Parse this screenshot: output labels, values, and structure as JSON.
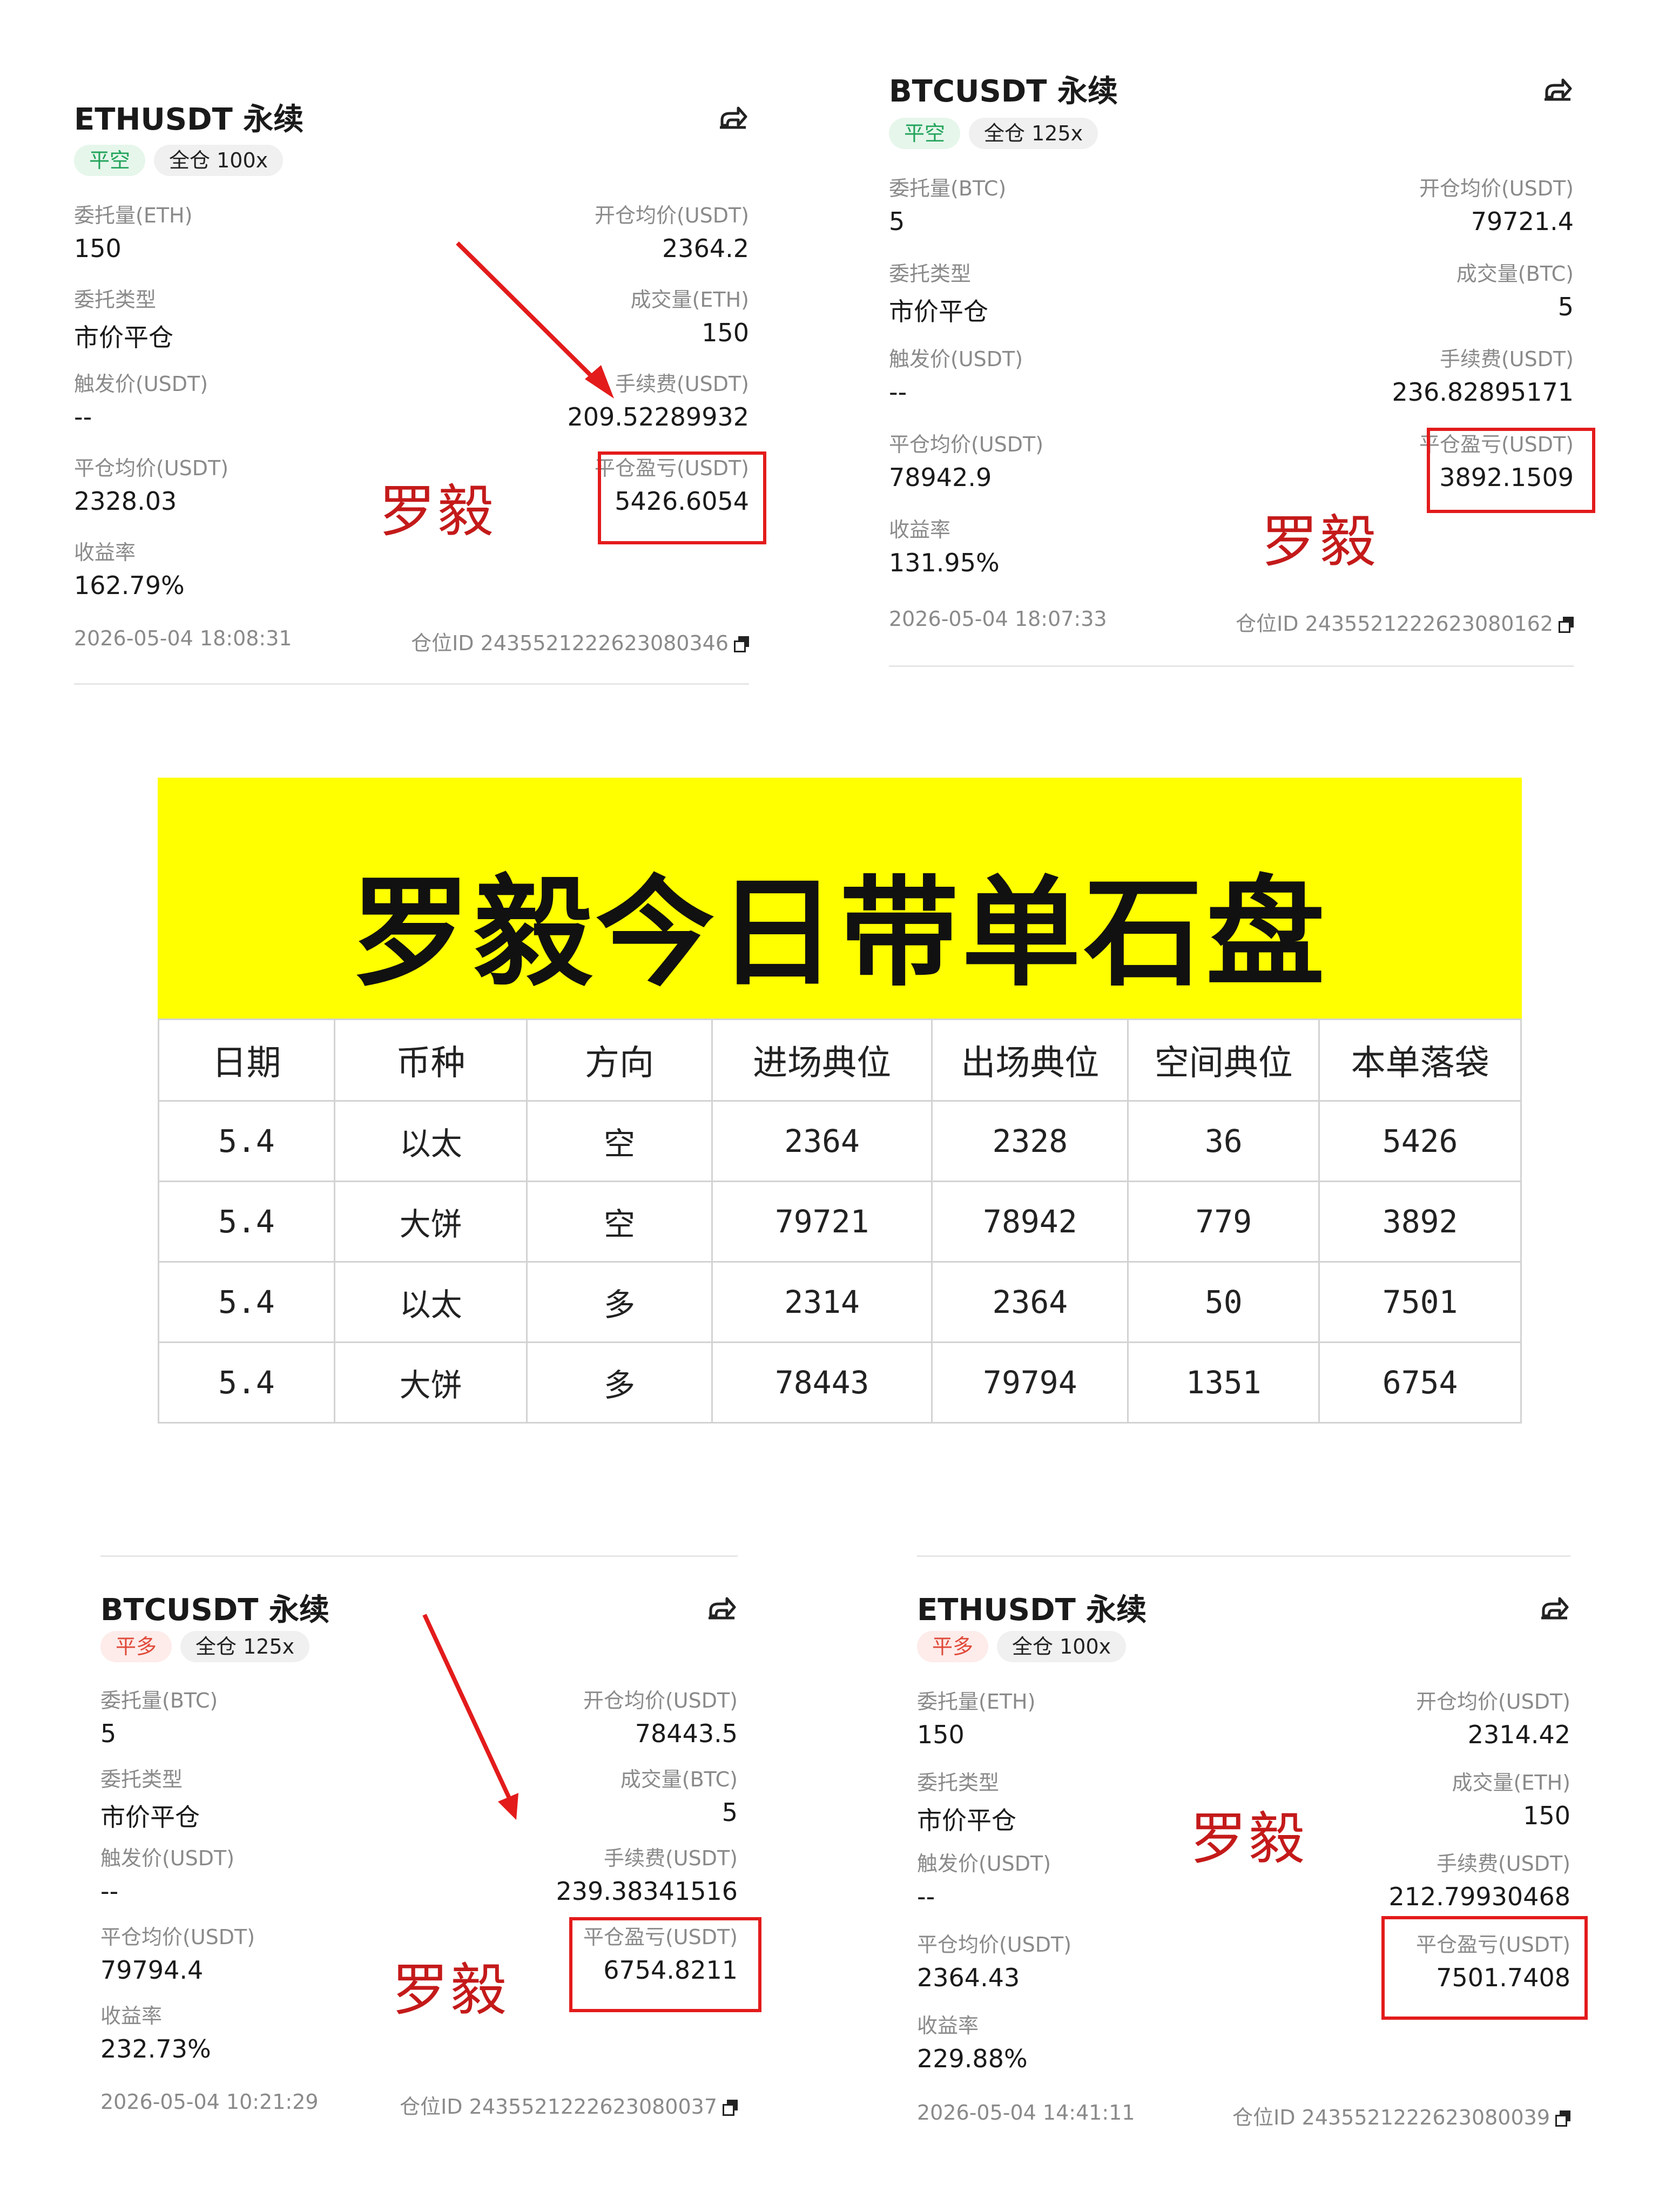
{
  "cards": [
    {
      "symbol": "ETHUSDT 永续",
      "side": "平空",
      "leverage": "全仓 100x",
      "order_qty_label": "委托量(ETH)",
      "order_qty": "150",
      "open_avg_label": "开仓均价(USDT)",
      "open_avg": "2364.2",
      "order_type_label": "委托类型",
      "order_type": "市价平仓",
      "filled_label": "成交量(ETH)",
      "filled": "150",
      "trigger_label": "触发价(USDT)",
      "trigger": "--",
      "fee_label": "手续费(USDT)",
      "fee": "209.52289932",
      "close_avg_label": "平仓均价(USDT)",
      "close_avg": "2328.03",
      "pnl_label": "平仓盈亏(USDT)",
      "pnl": "5426.6054",
      "roi_label": "收益率",
      "roi": "162.79%",
      "time": "2026-05-04 18:08:31",
      "position_id": "仓位ID 2435521222623080346"
    },
    {
      "symbol": "BTCUSDT 永续",
      "side": "平空",
      "leverage": "全仓 125x",
      "order_qty_label": "委托量(BTC)",
      "order_qty": "5",
      "open_avg_label": "开仓均价(USDT)",
      "open_avg": "79721.4",
      "order_type_label": "委托类型",
      "order_type": "市价平仓",
      "filled_label": "成交量(BTC)",
      "filled": "5",
      "trigger_label": "触发价(USDT)",
      "trigger": "--",
      "fee_label": "手续费(USDT)",
      "fee": "236.82895171",
      "close_avg_label": "平仓均价(USDT)",
      "close_avg": "78942.9",
      "pnl_label": "平仓盈亏(USDT)",
      "pnl": "3892.1509",
      "roi_label": "收益率",
      "roi": "131.95%",
      "time": "2026-05-04 18:07:33",
      "position_id": "仓位ID 2435521222623080162"
    },
    {
      "symbol": "BTCUSDT 永续",
      "side": "平多",
      "leverage": "全仓 125x",
      "order_qty_label": "委托量(BTC)",
      "order_qty": "5",
      "open_avg_label": "开仓均价(USDT)",
      "open_avg": "78443.5",
      "order_type_label": "委托类型",
      "order_type": "市价平仓",
      "filled_label": "成交量(BTC)",
      "filled": "5",
      "trigger_label": "触发价(USDT)",
      "trigger": "--",
      "fee_label": "手续费(USDT)",
      "fee": "239.38341516",
      "close_avg_label": "平仓均价(USDT)",
      "close_avg": "79794.4",
      "pnl_label": "平仓盈亏(USDT)",
      "pnl": "6754.8211",
      "roi_label": "收益率",
      "roi": "232.73%",
      "time": "2026-05-04 10:21:29",
      "position_id": "仓位ID 2435521222623080037"
    },
    {
      "symbol": "ETHUSDT 永续",
      "side": "平多",
      "leverage": "全仓 100x",
      "order_qty_label": "委托量(ETH)",
      "order_qty": "150",
      "open_avg_label": "开仓均价(USDT)",
      "open_avg": "2314.42",
      "order_type_label": "委托类型",
      "order_type": "市价平仓",
      "filled_label": "成交量(ETH)",
      "filled": "150",
      "trigger_label": "触发价(USDT)",
      "trigger": "--",
      "fee_label": "手续费(USDT)",
      "fee": "212.79930468",
      "close_avg_label": "平仓均价(USDT)",
      "close_avg": "2364.43",
      "pnl_label": "平仓盈亏(USDT)",
      "pnl": "7501.7408",
      "roi_label": "收益率",
      "roi": "229.88%",
      "time": "2026-05-04 14:41:11",
      "position_id": "仓位ID 2435521222623080039"
    }
  ],
  "watermark": "罗毅",
  "banner_title": "罗毅今日带单石盘",
  "table": {
    "headers": [
      "日期",
      "币种",
      "方向",
      "进场典位",
      "出场典位",
      "空间典位",
      "本单落袋"
    ],
    "rows": [
      [
        "5.4",
        "以太",
        "空",
        "2364",
        "2328",
        "36",
        "5426"
      ],
      [
        "5.4",
        "大饼",
        "空",
        "79721",
        "78942",
        "779",
        "3892"
      ],
      [
        "5.4",
        "以太",
        "多",
        "2314",
        "2364",
        "50",
        "7501"
      ],
      [
        "5.4",
        "大饼",
        "多",
        "78443",
        "79794",
        "1351",
        "6754"
      ]
    ]
  },
  "colors": {
    "annotation_red": "#e31b1b",
    "watermark_red": "#c41a1a",
    "banner_yellow": "#ffff00",
    "short_green": "#21a35a",
    "long_red": "#e04a3a"
  }
}
